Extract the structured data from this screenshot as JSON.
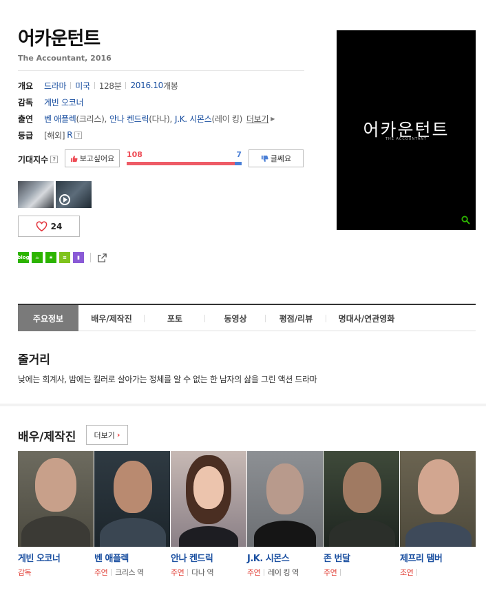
{
  "movie": {
    "title": "어카운턴트",
    "subtitle": "The Accountant, 2016"
  },
  "info": {
    "overview_label": "개요",
    "genre": "드라마",
    "country": "미국",
    "runtime": "128분",
    "release_date": "2016.10",
    "release_suffix": "개봉",
    "director_label": "감독",
    "director": "게빈 오코너",
    "cast_label": "출연",
    "cast1": "벤 애플렉",
    "cast1_role": "(크리스),",
    "cast2": "안나 켄드릭",
    "cast2_role": "(다나),",
    "cast3": "J.K. 시몬스",
    "cast3_role": "(레이 킹)",
    "more": "더보기",
    "rating_label": "등급",
    "rating_prefix": "[해외]",
    "rating": "R"
  },
  "expect": {
    "label": "기대지수",
    "want_label": "보고싶어요",
    "meh_label": "글쎄요",
    "want_count": "108",
    "meh_count": "7",
    "want_ratio": 0.939
  },
  "like": {
    "count": "24"
  },
  "poster": {
    "title": "어카운턴트",
    "subtitle": "THE ACCOUNTANT"
  },
  "tabs": [
    {
      "label": "주요정보"
    },
    {
      "label": "배우/제작진"
    },
    {
      "label": "포토"
    },
    {
      "label": "동영상"
    },
    {
      "label": "평점/리뷰"
    },
    {
      "label": "명대사/연관영화"
    }
  ],
  "synopsis": {
    "heading": "줄거리",
    "text": "낮에는 회계사, 밤에는 킬러로 살아가는 정체를 알 수 없는 한 남자의 삶을 그린 액션 드라마"
  },
  "cast_section": {
    "heading": "배우/제작진",
    "more_label": "더보기",
    "people": [
      {
        "name": "게빈 오코너",
        "role": "감독",
        "character": ""
      },
      {
        "name": "벤 애플렉",
        "role": "주연",
        "character": "크리스 역"
      },
      {
        "name": "안나 켄드릭",
        "role": "주연",
        "character": "다나 역"
      },
      {
        "name": "J.K. 시몬스",
        "role": "주연",
        "character": "레이 킹 역"
      },
      {
        "name": "존 번달",
        "role": "주연",
        "character": ""
      },
      {
        "name": "제프리 탬버",
        "role": "조연",
        "character": ""
      }
    ]
  },
  "colors": {
    "positive": "#ee5b66",
    "negative": "#4a7fd6",
    "link": "#1a4fa0",
    "role": "#e2443b"
  }
}
